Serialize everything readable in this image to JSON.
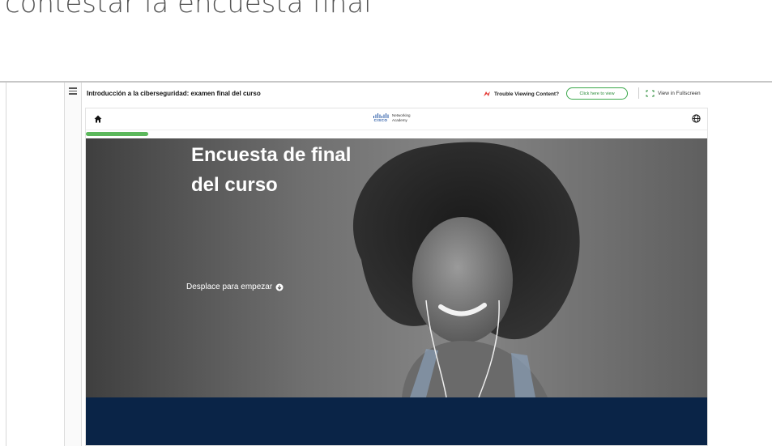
{
  "page_heading": "contestar la encuesta final",
  "titlebar": {
    "course_title": "Introducción a la ciberseguridad: examen final del curso",
    "trouble_text": "Trouble Viewing Content?",
    "click_button": "Click here to view",
    "fullscreen_text": "View in Fullscreen"
  },
  "module": {
    "logo_word": "CISCO",
    "logo_line1": "Networking",
    "logo_line2": "Academy",
    "progress_fraction": 0.1
  },
  "hero": {
    "title_line1": "Encuesta de final",
    "title_line2": "del curso",
    "scroll_cue": "Desplace para empezar"
  },
  "colors": {
    "accent_green": "#5cb85c",
    "footer_navy": "#0a2447"
  }
}
